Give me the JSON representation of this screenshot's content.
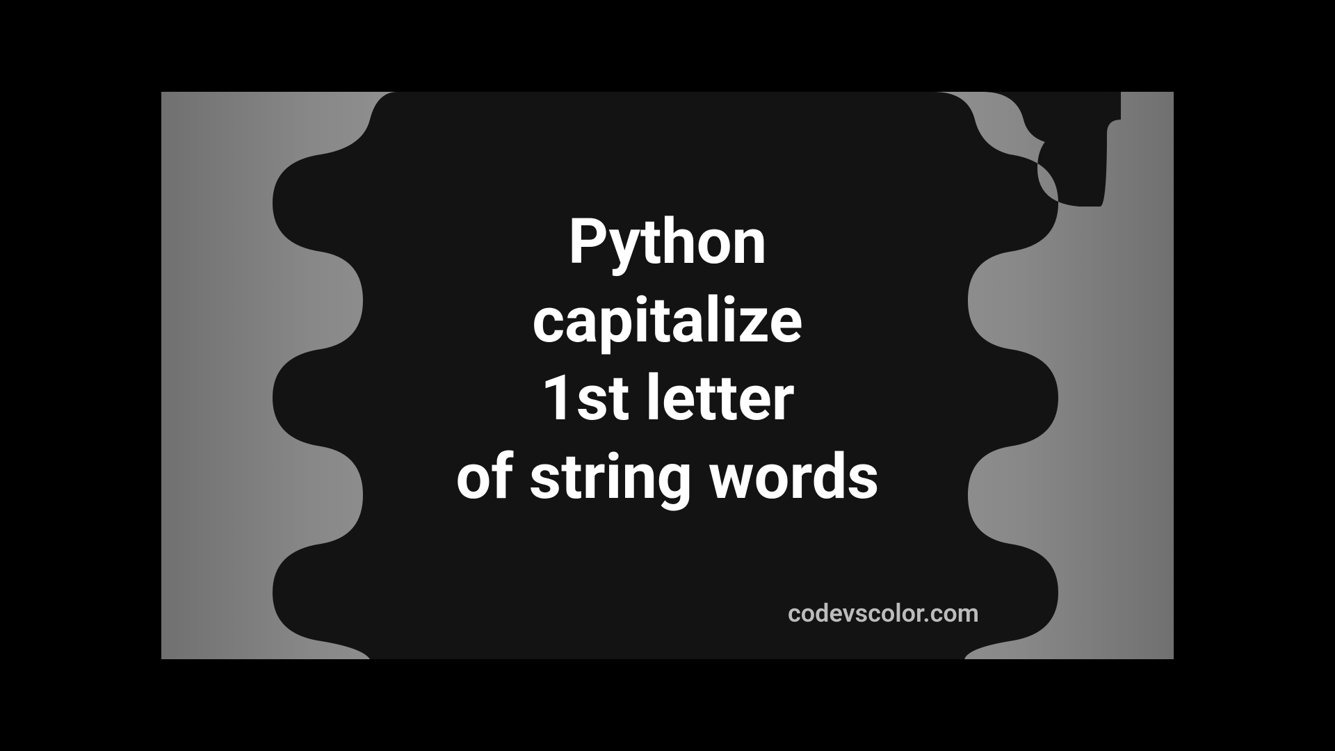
{
  "title": "Python\ncapitalize\n1st letter\nof string words",
  "watermark": "codevscolor.com",
  "colors": {
    "blob": "#131313",
    "text": "#ffffff",
    "watermark": "#bcbcbc"
  }
}
